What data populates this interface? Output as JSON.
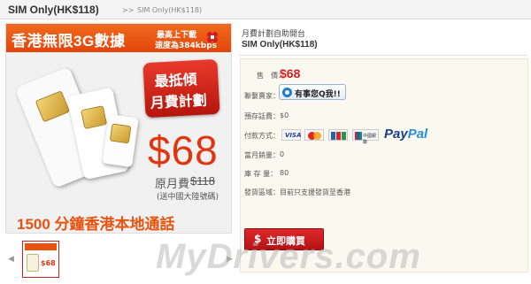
{
  "header": {
    "title": "SIM Only(HK$118)",
    "breadcrumb_sep": ">>",
    "breadcrumb": "SIM Only(HK$118)"
  },
  "banner": {
    "title": "香港無限3G數據",
    "speed_line1": "最高上下載",
    "speed_line2": "速度為384kbps",
    "badge_line1": "最抵傾",
    "badge_line2": "月費計劃",
    "price": "$68",
    "original_label": "原月費",
    "original_price": "$118",
    "gift_note": "(送中國大陸號碼)",
    "minutes": "1500 分鐘香港本地通話"
  },
  "thumbnail": {
    "arrow_left": "◀",
    "arrow_right": "▶",
    "price": "$68"
  },
  "product": {
    "category": "月費計劃自助開台",
    "name": "SIM Only(HK$118)",
    "price_label": "售　價：",
    "price_value": "$68",
    "seller_label": "聯繫賣家：",
    "chat_text": "有事您Q我!!",
    "prepaid_label": "預存話費：",
    "prepaid_value": "$0",
    "payment_label": "付款方式：",
    "payment_visa": "VISA",
    "payment_union": "中國銀聯",
    "payment_paypal_1": "Pay",
    "payment_paypal_2": "Pal",
    "sales_label": "當月銷量：",
    "sales_value": "0",
    "stock_label": "庫 存 量：",
    "stock_value": "80",
    "area_label": "發貨區域：",
    "area_value": "目前只支援發貨至香港",
    "buy_icon": "$",
    "buy_label": "立即購買"
  },
  "watermark": "MyDrivers.com",
  "colors": {
    "accent_orange": "#e8530f",
    "price_red": "#d11f1f",
    "buy_button": "#c81b1d"
  }
}
